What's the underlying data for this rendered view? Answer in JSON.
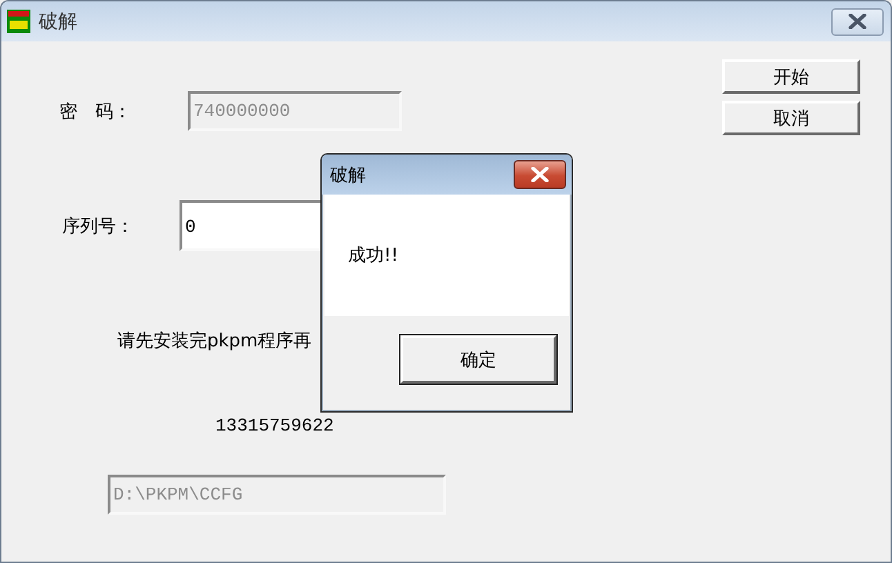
{
  "window": {
    "title": "破解"
  },
  "form": {
    "password": {
      "label": "密　码：",
      "value": "740000000",
      "disabled": true
    },
    "serial": {
      "label": "序列号：",
      "value": "0",
      "disabled": false
    },
    "note": "请先安装完pkpm程序再",
    "phone": "13315759622",
    "path": {
      "value": "D:\\PKPM\\CCFG",
      "disabled": true
    }
  },
  "buttons": [
    "开始",
    "取消"
  ],
  "dialog": {
    "title": "破解",
    "message": "成功!!",
    "button": "确定"
  }
}
